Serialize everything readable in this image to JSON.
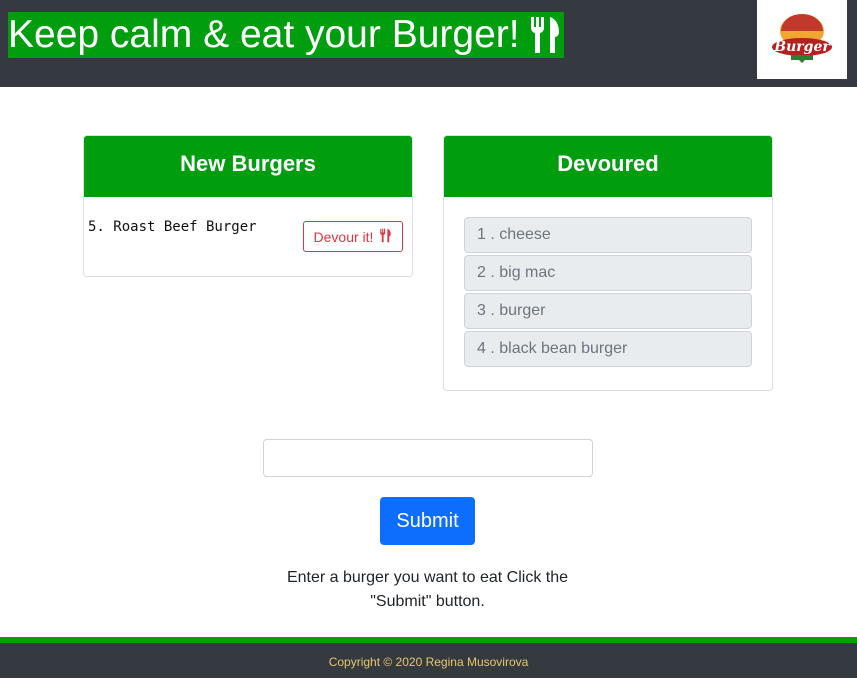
{
  "header": {
    "title": "Keep calm & eat your Burger!",
    "title_icon": "utensils-icon",
    "logo_text": "Burger",
    "colors": {
      "navbar": "#343a40",
      "title_bg": "#009e0f"
    }
  },
  "new_burgers": {
    "heading": "New Burgers",
    "items": [
      {
        "label": "5. Roast Beef Burger",
        "button": "Devour it!"
      }
    ]
  },
  "devoured": {
    "heading": "Devoured",
    "items": [
      {
        "label": "1 . cheese"
      },
      {
        "label": "2 . big mac"
      },
      {
        "label": "3 . burger"
      },
      {
        "label": "4 . black bean burger"
      }
    ]
  },
  "form": {
    "input_value": "",
    "submit_label": "Submit",
    "instructions": "Enter a burger you want to eat Click the \"Submit\" button."
  },
  "footer": {
    "copyright": "Copyright © 2020 Regina Musovirova"
  },
  "colors": {
    "accent_green": "#009e0f",
    "danger": "#dc3545",
    "primary": "#0d6efd",
    "footer_text": "#e8c66b"
  }
}
